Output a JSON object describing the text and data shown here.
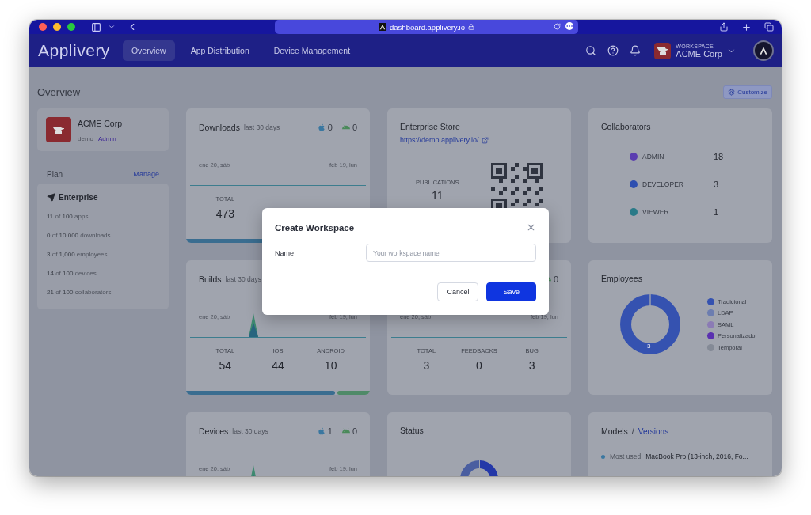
{
  "browser": {
    "url": "dashboard.applivery.io"
  },
  "header": {
    "logo": "Applivery",
    "tabs": [
      {
        "label": "Overview",
        "selected": true
      },
      {
        "label": "App Distribution",
        "selected": false
      },
      {
        "label": "Device Management",
        "selected": false
      }
    ],
    "workspace": {
      "caption": "WORKSPACE",
      "name": "ACME Corp"
    }
  },
  "page": {
    "title": "Overview",
    "customize": "Customize"
  },
  "account": {
    "name": "ACME Corp",
    "slug": "demo",
    "role": "Admin"
  },
  "plan": {
    "label": "Plan",
    "manage": "Manage",
    "name": "Enterprise",
    "limits": [
      {
        "used": "11",
        "of": "of",
        "max": "100",
        "unit": "apps"
      },
      {
        "used": "0",
        "of": "of",
        "max": "10,000",
        "unit": "downloads"
      },
      {
        "used": "3",
        "of": "of",
        "max": "1,000",
        "unit": "employees"
      },
      {
        "used": "14",
        "of": "of",
        "max": "100",
        "unit": "devices"
      },
      {
        "used": "21",
        "of": "of",
        "max": "100",
        "unit": "collaborators"
      }
    ]
  },
  "cards": [
    {
      "kind": "trend",
      "title": "Downloads",
      "subtitle": "last 30 days",
      "counts": [
        {
          "kind": "ios",
          "value": "0"
        },
        {
          "kind": "android",
          "value": "0"
        }
      ],
      "date_start": "ene 20, sáb",
      "date_end": "feb 19, lun",
      "chart": {
        "kind": "flat"
      },
      "stats": [
        {
          "label": "TOTAL",
          "value": "473"
        }
      ],
      "level": 1
    },
    {
      "kind": "store",
      "title": "Enterprise Store",
      "link": "https://demo.applivery.io/",
      "stat_label": "PUBLICATIONS",
      "stat_value": "11"
    },
    {
      "kind": "roles",
      "title": "Collaborators",
      "roles": [
        {
          "name": "ADMIN",
          "count": "18",
          "color": "#5a3db0"
        },
        {
          "name": "DEVELOPER",
          "count": "3",
          "color": "#2e4fb0"
        },
        {
          "name": "VIEWER",
          "count": "1",
          "color": "#2a7a88"
        }
      ]
    },
    {
      "kind": "trend",
      "title": "Builds",
      "subtitle": "last 30 days",
      "date_start": "ene 20, sáb",
      "date_end": "feb 19, lun",
      "chart": {
        "kind": "spike"
      },
      "stats": [
        {
          "label": "TOTAL",
          "value": "54"
        },
        {
          "label": "IOS",
          "value": "44"
        },
        {
          "label": "ANDROID",
          "value": "10"
        }
      ],
      "level": 0.81
    },
    {
      "kind": "trend",
      "counts": [
        {
          "kind": "android",
          "value": "0"
        }
      ],
      "date_start": "ene 20, sáb",
      "date_end": "feb 19, lun",
      "chart": {
        "kind": "flat"
      },
      "stats": [
        {
          "label": "TOTAL",
          "value": "3"
        },
        {
          "label": "FEEDBACKS",
          "value": "0"
        },
        {
          "label": "BUG",
          "value": "3"
        }
      ]
    },
    {
      "kind": "donut",
      "title": "Employees",
      "center_label": "3",
      "legend": [
        {
          "name": "Tradicional",
          "color": "#3552b0"
        },
        {
          "name": "LDAP",
          "color": "#6c7db0"
        },
        {
          "name": "SAML",
          "color": "#8b7bb5"
        },
        {
          "name": "Personalizado",
          "color": "#5a30b0"
        },
        {
          "name": "Temporal",
          "color": "#848a96"
        }
      ]
    },
    {
      "kind": "trend",
      "title": "Devices",
      "subtitle": "last 30 days",
      "counts": [
        {
          "kind": "ios",
          "value": "1"
        },
        {
          "kind": "android",
          "value": "0"
        }
      ],
      "date_start": "ene 20, sáb",
      "date_end": "feb 19, lun",
      "chart": {
        "kind": "spike"
      }
    },
    {
      "kind": "status",
      "title": "Status"
    },
    {
      "kind": "models",
      "title": "Models",
      "separator": "/",
      "link": "Versions",
      "row_label": "Most used",
      "row_value": "MacBook Pro (13-inch, 2016, Fo..."
    }
  ],
  "modal": {
    "title": "Create Workspace",
    "field_label": "Name",
    "placeholder": "Your workspace name",
    "buttons": [
      {
        "label": "Cancel",
        "kind": "secondary"
      },
      {
        "label": "Save",
        "kind": "primary"
      }
    ]
  }
}
